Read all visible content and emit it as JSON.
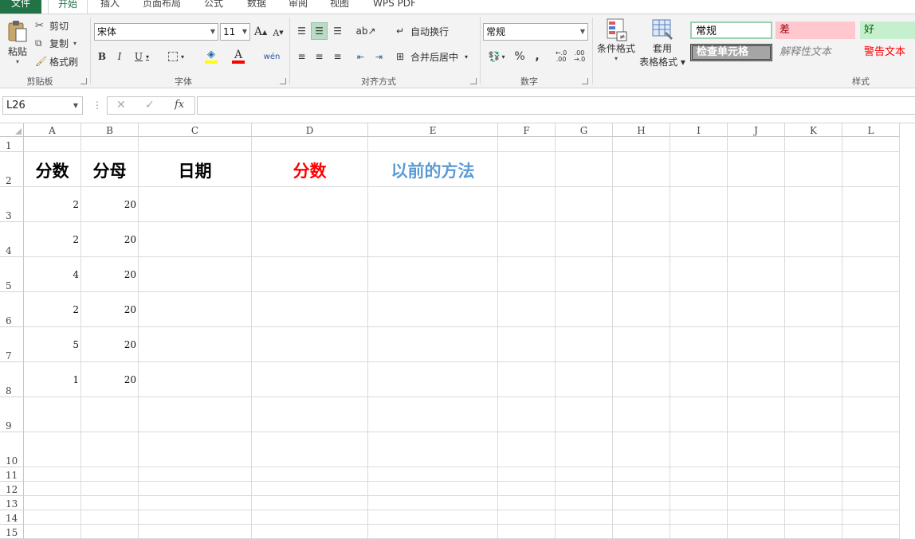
{
  "ribbon_tabs": [
    "文件",
    "开始",
    "插入",
    "页面布局",
    "公式",
    "数据",
    "审阅",
    "视图",
    "WPS PDF"
  ],
  "clipboard": {
    "paste": "粘贴",
    "cut": "剪切",
    "copy": "复制",
    "format_painter": "格式刷",
    "group": "剪贴板"
  },
  "font": {
    "name": "宋体",
    "size": "11",
    "grow": "A",
    "shrink": "A",
    "bold": "B",
    "italic": "I",
    "underline": "U",
    "fill_color": "#ffff00",
    "font_color": "#ff0000",
    "phonetic": "wén",
    "group": "字体"
  },
  "alignment": {
    "wrap_text": "自动换行",
    "merge_center": "合并后居中",
    "group": "对齐方式"
  },
  "number": {
    "format": "常规",
    "percent": "%",
    "comma": ",",
    "inc_decimal": "←.0\n.00",
    "dec_decimal": ".00\n→.0",
    "group": "数字"
  },
  "styles_group": {
    "conditional_format": "条件格式",
    "table_format_1": "套用",
    "table_format_2": "表格格式",
    "normal": "常规",
    "bad": "差",
    "good": "好",
    "check_cell": "检查单元格",
    "explanatory": "解释性文本",
    "warning": "警告文本",
    "group": "样式",
    "bad_bg": "#ffc7ce",
    "bad_fg": "#9c0006",
    "good_bg": "#c6efce",
    "good_fg": "#006100",
    "check_bg": "#a5a5a5",
    "warning_fg": "#ff0000"
  },
  "formula_bar": {
    "cell_ref": "L26",
    "cancel": "✕",
    "enter": "✓",
    "fx": "fx",
    "content": ""
  },
  "columns": [
    "A",
    "B",
    "C",
    "D",
    "E",
    "F",
    "G",
    "H",
    "I",
    "J",
    "K",
    "L"
  ],
  "rows": [
    "1",
    "2",
    "3",
    "4",
    "5",
    "6",
    "7",
    "8",
    "9",
    "10",
    "11",
    "12",
    "13",
    "14",
    "15"
  ],
  "sheet": {
    "headers": {
      "A2": "分数",
      "B2": "分母",
      "C2": "日期",
      "D2": "分数",
      "E2": "以前的方法"
    },
    "header_colors": {
      "D2": "#ff0000",
      "E2": "#5b9bd5",
      "default": "#000000"
    },
    "col_a": [
      "2",
      "2",
      "4",
      "2",
      "5",
      "1"
    ],
    "col_b": [
      "20",
      "20",
      "20",
      "20",
      "20",
      "20"
    ]
  }
}
